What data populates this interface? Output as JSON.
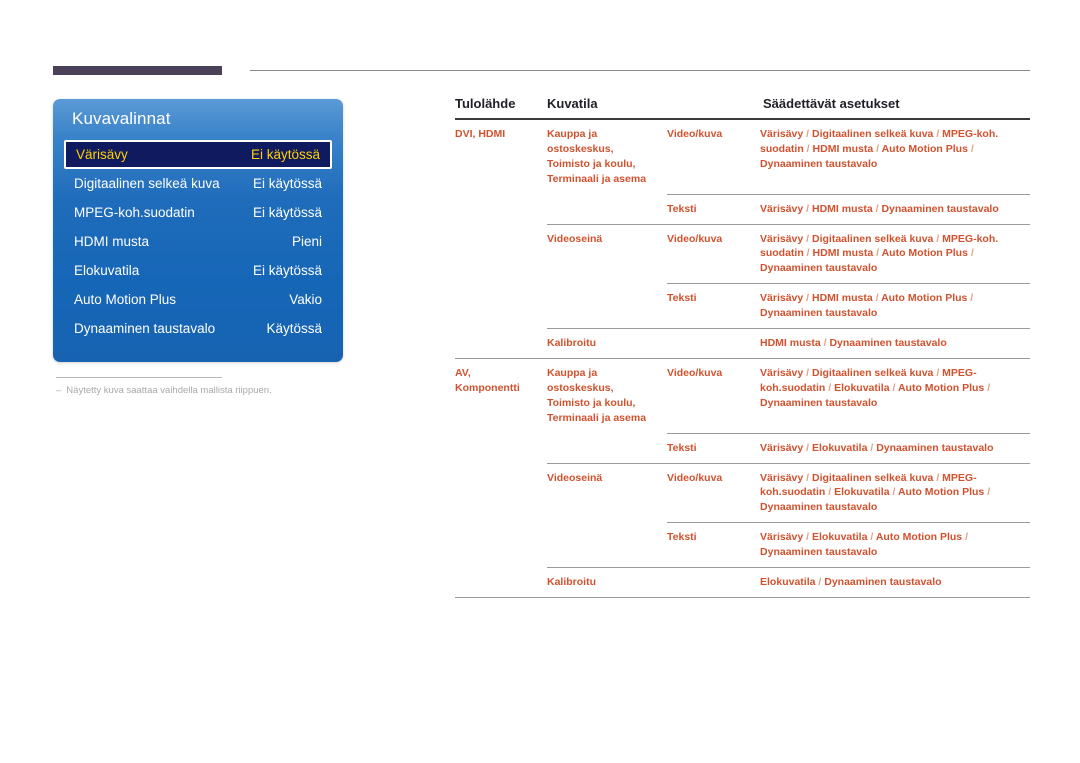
{
  "header": {
    "accent_color": "#4a4158",
    "rule_color": "#8a8a8a"
  },
  "osd": {
    "title": "Kuvavalinnat",
    "accent_color": "#1f6cbb",
    "highlight_bg": "#101a5e",
    "highlight_text_color": "#ffd200",
    "items": [
      {
        "label": "Värisävy",
        "value": "Ei käytössä",
        "selected": true
      },
      {
        "label": "Digitaalinen selkeä kuva",
        "value": "Ei käytössä",
        "selected": false
      },
      {
        "label": "MPEG-koh.suodatin",
        "value": "Ei käytössä",
        "selected": false
      },
      {
        "label": "HDMI musta",
        "value": "Pieni",
        "selected": false
      },
      {
        "label": "Elokuvatila",
        "value": "Ei käytössä",
        "selected": false
      },
      {
        "label": "Auto Motion Plus",
        "value": "Vakio",
        "selected": false
      },
      {
        "label": "Dynaaminen taustavalo",
        "value": "Käytössä",
        "selected": false
      }
    ]
  },
  "note": {
    "dash": "‒",
    "text": "Näytetty kuva saattaa vaihdella mallista riippuen."
  },
  "table": {
    "text_color": "#d1522e",
    "headers": {
      "source": "Tulolähde",
      "mode": "Kuvatila",
      "sub": "",
      "adjustable": "Säädettävät asetukset"
    },
    "groups": [
      {
        "source": "DVI, HDMI",
        "source_line1": "DVI, HDMI",
        "source_line2": "",
        "modes": [
          {
            "mode": "Kauppa ja ostoskeskus, Toimisto ja koulu, Terminaali ja asema",
            "mode_lines": [
              "Kauppa ja",
              "ostoskeskus,",
              "Toimisto ja koulu,",
              "Terminaali ja asema"
            ],
            "rows": [
              {
                "sub": "Video/kuva",
                "adjustable": "Värisävy / Digitaalinen selkeä kuva / MPEG-koh. suodatin / HDMI musta / Auto Motion Plus / Dynaaminen taustavalo"
              },
              {
                "sub": "Teksti",
                "adjustable": "Värisävy / HDMI musta / Dynaaminen taustavalo"
              }
            ]
          },
          {
            "mode": "Videoseinä",
            "mode_lines": [
              "Videoseinä"
            ],
            "rows": [
              {
                "sub": "Video/kuva",
                "adjustable": "Värisävy / Digitaalinen selkeä kuva / MPEG-koh. suodatin / HDMI musta / Auto Motion Plus / Dynaaminen taustavalo"
              },
              {
                "sub": "Teksti",
                "adjustable": "Värisävy / HDMI musta / Auto Motion Plus / Dynaaminen taustavalo"
              }
            ]
          },
          {
            "mode": "Kalibroitu",
            "mode_lines": [
              "Kalibroitu"
            ],
            "rows": [
              {
                "sub": "",
                "adjustable": "HDMI musta / Dynaaminen taustavalo"
              }
            ]
          }
        ]
      },
      {
        "source": "AV, Komponentti",
        "source_line1": "AV,",
        "source_line2": "Komponentti",
        "modes": [
          {
            "mode": "Kauppa ja ostoskeskus, Toimisto ja koulu, Terminaali ja asema",
            "mode_lines": [
              "Kauppa ja",
              "ostoskeskus,",
              "Toimisto ja koulu,",
              "Terminaali ja asema"
            ],
            "rows": [
              {
                "sub": "Video/kuva",
                "adjustable": "Värisävy / Digitaalinen selkeä kuva / MPEG-koh.suodatin / Elokuvatila / Auto Motion Plus / Dynaaminen taustavalo"
              },
              {
                "sub": "Teksti",
                "adjustable": "Värisävy / Elokuvatila / Dynaaminen taustavalo"
              }
            ]
          },
          {
            "mode": "Videoseinä",
            "mode_lines": [
              "Videoseinä"
            ],
            "rows": [
              {
                "sub": "Video/kuva",
                "adjustable": "Värisävy / Digitaalinen selkeä kuva / MPEG-koh.suodatin / Elokuvatila / Auto Motion Plus / Dynaaminen taustavalo"
              },
              {
                "sub": "Teksti",
                "adjustable": "Värisävy / Elokuvatila / Auto Motion Plus / Dynaaminen taustavalo"
              }
            ]
          },
          {
            "mode": "Kalibroitu",
            "mode_lines": [
              "Kalibroitu"
            ],
            "rows": [
              {
                "sub": "",
                "adjustable": "Elokuvatila / Dynaaminen taustavalo"
              }
            ]
          }
        ]
      }
    ]
  }
}
